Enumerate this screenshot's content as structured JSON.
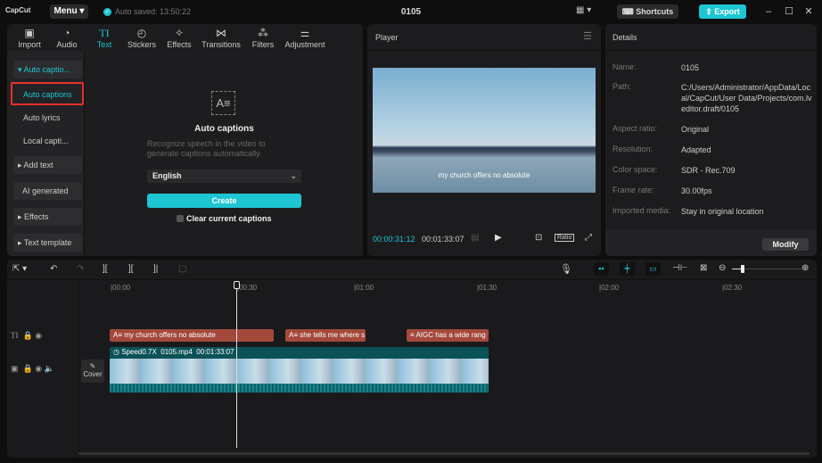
{
  "app": {
    "logo": "CapCut",
    "menu": "Menu",
    "autosave": "Auto saved: 13:50:22",
    "project_title": "0105",
    "shortcuts": "Shortcuts",
    "export": "Export",
    "accent": "#1ec5d2"
  },
  "tabs": [
    {
      "label": "Import",
      "icon": "import-icon"
    },
    {
      "label": "Audio",
      "icon": "audio-icon"
    },
    {
      "label": "Text",
      "icon": "text-icon",
      "active": true
    },
    {
      "label": "Stickers",
      "icon": "sticker-icon"
    },
    {
      "label": "Effects",
      "icon": "effects-icon"
    },
    {
      "label": "Transitions",
      "icon": "transition-icon"
    },
    {
      "label": "Filters",
      "icon": "filter-icon"
    },
    {
      "label": "Adjustment",
      "icon": "adjustment-icon"
    }
  ],
  "sidebar": {
    "group": "Auto captio...",
    "items": [
      "Auto captions",
      "Auto lyrics",
      "Local capti..."
    ],
    "buttons": [
      "Add text",
      "AI generated",
      "Effects",
      "Text template"
    ]
  },
  "captions_panel": {
    "title": "Auto captions",
    "description": "Recognize speech in the video to generate captions automatically.",
    "language": "English",
    "create": "Create",
    "clear_label": "Clear current captions"
  },
  "player": {
    "title": "Player",
    "subtitle": "my church offers no absolute",
    "current": "00:00:31:12",
    "total": "00:01:33:07",
    "ratio": "Ratio"
  },
  "details": {
    "title": "Details",
    "rows": [
      {
        "k": "Name:",
        "v": "0105"
      },
      {
        "k": "Path:",
        "v": "C:/Users/Administrator/AppData/Local/CapCut/User Data/Projects/com.lveditor.draft/0105"
      },
      {
        "k": "Aspect ratio:",
        "v": "Original"
      },
      {
        "k": "Resolution:",
        "v": "Adapted"
      },
      {
        "k": "Color space:",
        "v": "SDR - Rec.709"
      },
      {
        "k": "Frame rate:",
        "v": "30.00fps"
      },
      {
        "k": "Imported media:",
        "v": "Stay in original location"
      }
    ],
    "modify": "Modify"
  },
  "timeline": {
    "ticks": [
      "00:00",
      "00:30",
      "01:00",
      "01:30",
      "02:00",
      "02:30"
    ],
    "captions": [
      "my church offers no absolute",
      "she tells me where s",
      "AIGC has a wide rang"
    ],
    "clip": {
      "speed": "Speed0.7X",
      "name": "0105.mp4",
      "duration": "00:01:33:07"
    },
    "cover": "Cover"
  }
}
